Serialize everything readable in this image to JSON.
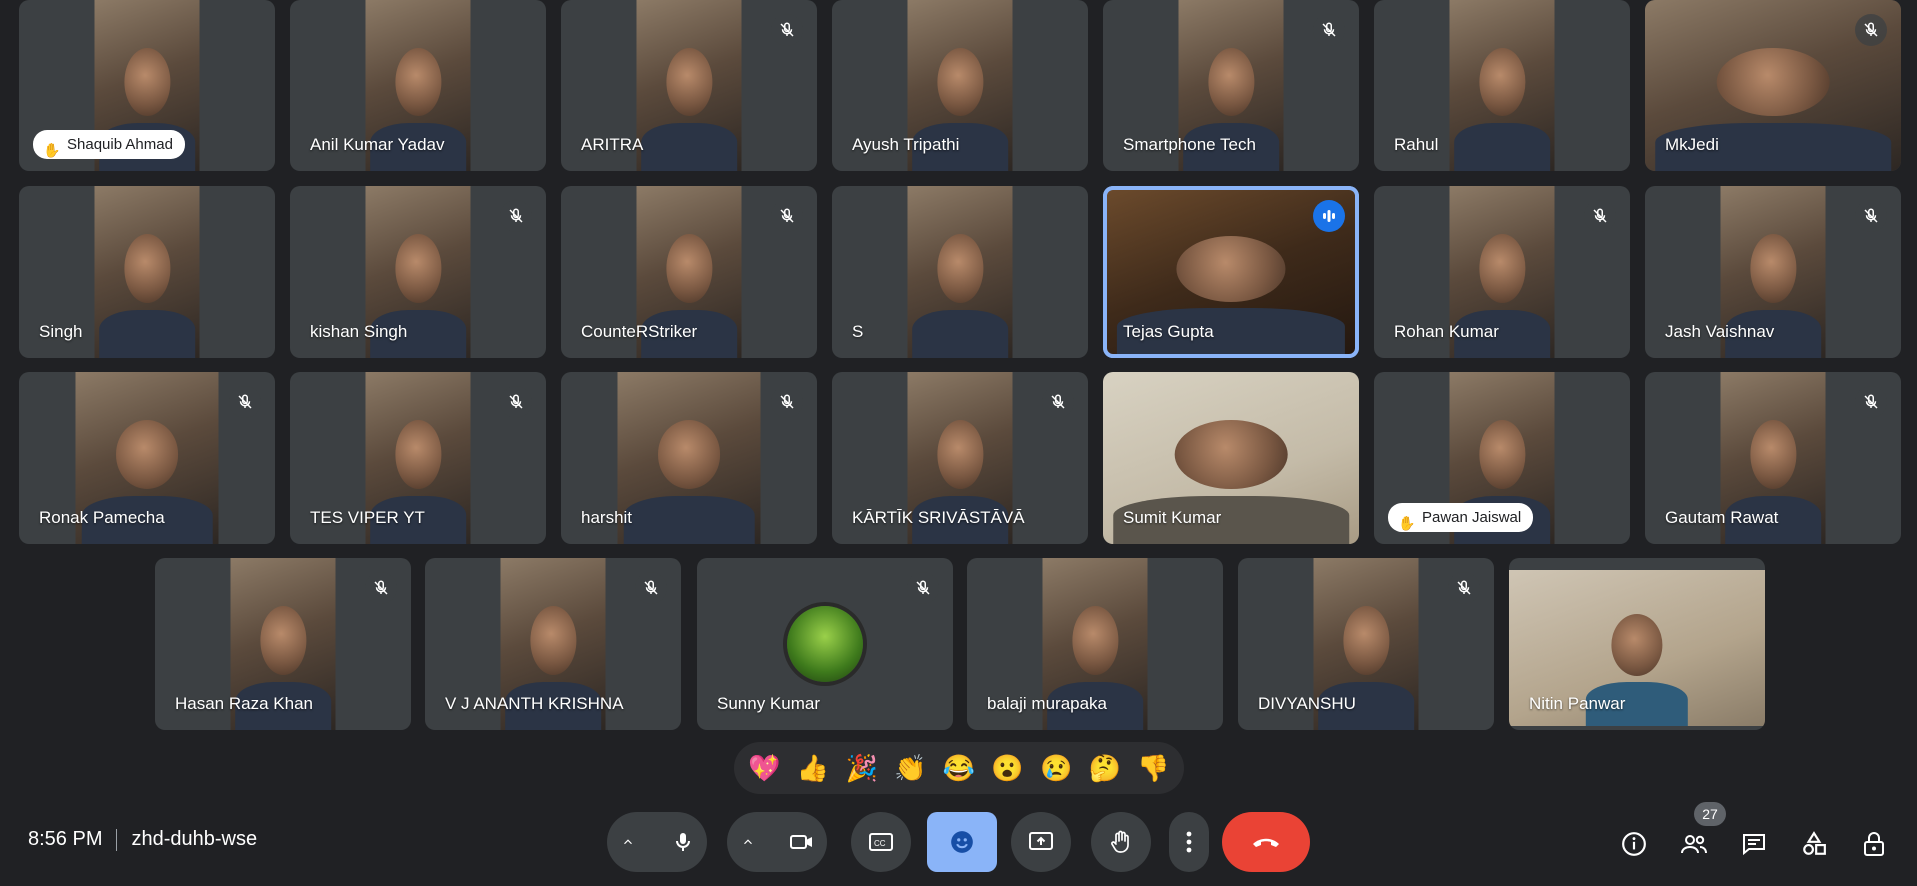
{
  "participants": [
    {
      "name": "Shaquib Ahmad",
      "muted": false,
      "hand_raised": true
    },
    {
      "name": "Anil Kumar Yadav",
      "muted": false
    },
    {
      "name": "ARITRA",
      "muted": true
    },
    {
      "name": "Ayush Tripathi",
      "muted": false
    },
    {
      "name": "Smartphone Tech",
      "muted": true
    },
    {
      "name": "Rahul",
      "muted": false
    },
    {
      "name": "MkJedi",
      "muted": true
    },
    {
      "name": "Singh",
      "muted": false
    },
    {
      "name": "kishan Singh",
      "muted": true
    },
    {
      "name": "CounteRStriker",
      "muted": true
    },
    {
      "name": "S",
      "muted": false
    },
    {
      "name": "Tejas Gupta",
      "muted": false,
      "speaking": true
    },
    {
      "name": "Rohan Kumar",
      "muted": true
    },
    {
      "name": "Jash Vaishnav",
      "muted": true
    },
    {
      "name": "Ronak Pamecha",
      "muted": true
    },
    {
      "name": "TES VIPER YT",
      "muted": true
    },
    {
      "name": "harshit",
      "muted": true
    },
    {
      "name": "KĀRTĪK SRIVĀSTĀVĀ",
      "muted": true
    },
    {
      "name": "Sumit Kumar",
      "muted": false
    },
    {
      "name": "Pawan Jaiswal",
      "muted": false,
      "hand_raised": true
    },
    {
      "name": "Gautam Rawat",
      "muted": true
    },
    {
      "name": "Hasan Raza Khan",
      "muted": true
    },
    {
      "name": "V J ANANTH KRISHNA",
      "muted": true
    },
    {
      "name": "Sunny Kumar",
      "muted": true
    },
    {
      "name": "balaji murapaka",
      "muted": false
    },
    {
      "name": "DIVYANSHU",
      "muted": true
    },
    {
      "name": "Nitin Panwar",
      "muted": false
    }
  ],
  "reactions": [
    "💖",
    "👍",
    "🎉",
    "👏",
    "😂",
    "😮",
    "😢",
    "🤔",
    "👎"
  ],
  "meeting": {
    "time": "8:56 PM",
    "code": "zhd-duhb-wse",
    "participant_count": "27"
  },
  "colors": {
    "background": "#202124",
    "tile": "#3c4043",
    "speaking_border": "#8ab4f8",
    "leave_button": "#ea4335",
    "reactions_button_active": "#8ab4f8"
  },
  "icons": {
    "mic": "microphone-icon",
    "camera": "camera-icon",
    "captions": "closed-captions-icon",
    "reactions": "emoji-icon",
    "present": "present-screen-icon",
    "raise_hand": "hand-icon",
    "more": "more-vertical-icon",
    "leave": "end-call-icon",
    "info": "info-icon",
    "people": "people-icon",
    "chat": "chat-icon",
    "activities": "activities-icon",
    "host_controls": "host-controls-lock-icon"
  }
}
